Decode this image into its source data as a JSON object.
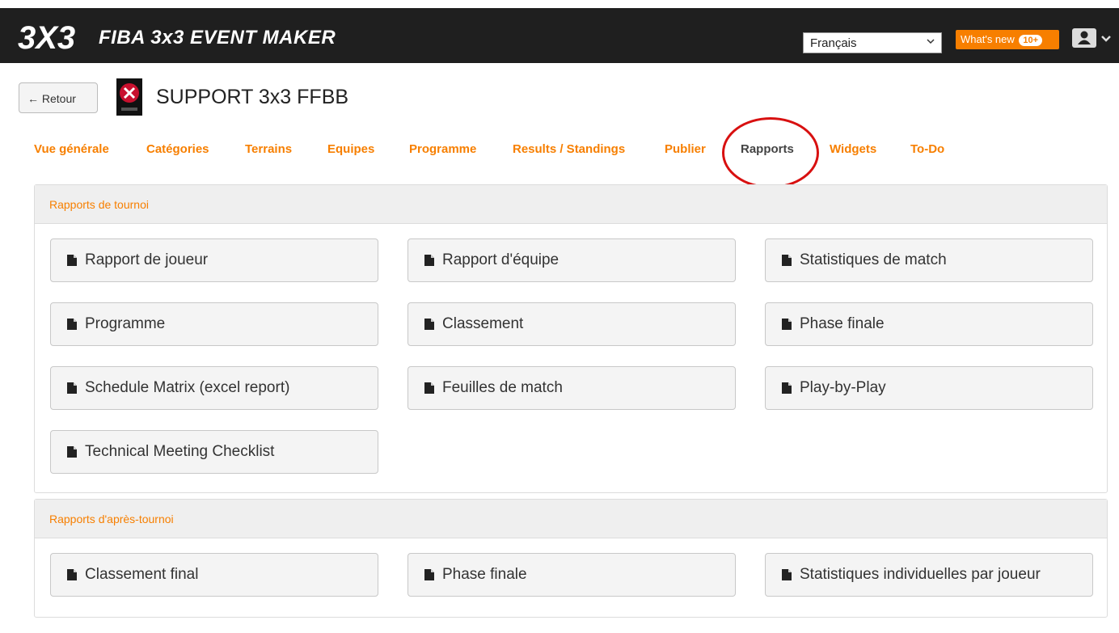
{
  "header": {
    "logo_text": "3X3",
    "brand_title": "FIBA 3x3 EVENT MAKER",
    "language": "Français",
    "whats_new_label": "What's new",
    "whats_new_badge": "10+"
  },
  "event": {
    "back_label": "Retour",
    "title": "SUPPORT 3x3 FFBB"
  },
  "tabs": [
    {
      "label": "Vue générale",
      "active": false
    },
    {
      "label": "Catégories",
      "active": false
    },
    {
      "label": "Terrains",
      "active": false
    },
    {
      "label": "Equipes",
      "active": false
    },
    {
      "label": "Programme",
      "active": false
    },
    {
      "label": "Results / Standings",
      "active": false
    },
    {
      "label": "Publier",
      "active": false
    },
    {
      "label": "Rapports",
      "active": true
    },
    {
      "label": "Widgets",
      "active": false
    },
    {
      "label": "To-Do",
      "active": false
    }
  ],
  "panels": {
    "tournament": {
      "title": "Rapports de tournoi",
      "reports": [
        "Rapport de joueur",
        "Rapport d'équipe",
        "Statistiques de match",
        "Programme",
        "Classement",
        "Phase finale",
        "Schedule Matrix (excel report)",
        "Feuilles de match",
        "Play-by-Play",
        "Technical Meeting Checklist"
      ]
    },
    "post_tournament": {
      "title": "Rapports d'après-tournoi",
      "reports": [
        "Classement final",
        "Phase finale",
        "Statistiques individuelles par joueur"
      ]
    }
  },
  "colors": {
    "accent": "#f77f00",
    "topbar": "#1f1f1f",
    "highlight_circle": "#d81010"
  }
}
